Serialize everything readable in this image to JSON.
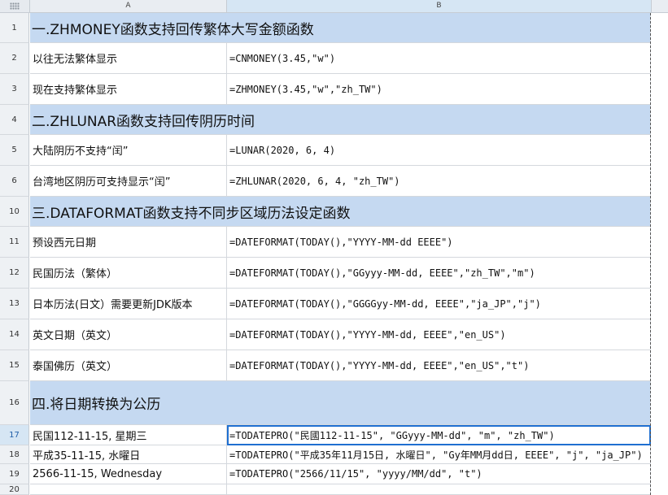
{
  "columns": {
    "a": "A",
    "b": "B"
  },
  "rows": [
    {
      "num": "1",
      "type": "header",
      "text": "一.ZHMONEY函数支持回传繁体大写金额函数"
    },
    {
      "num": "2",
      "type": "data",
      "a": "以往无法繁体显示",
      "b": "=CNMONEY(3.45,\"w\")"
    },
    {
      "num": "3",
      "type": "data",
      "a": "现在支持繁体显示",
      "b": "=ZHMONEY(3.45,\"w\",\"zh_TW\")"
    },
    {
      "num": "4",
      "type": "header",
      "text": "二.ZHLUNAR函数支持回传阴历时间"
    },
    {
      "num": "5",
      "type": "data",
      "a": "大陆阴历不支持“闰”",
      "b": "=LUNAR(2020, 6, 4)"
    },
    {
      "num": "6",
      "type": "data",
      "a": "台湾地区阴历可支持显示“闰”",
      "b": "=ZHLUNAR(2020, 6, 4, \"zh_TW\")"
    },
    {
      "num": "10",
      "type": "header",
      "text": "三.DATAFORMAT函数支持不同步区域历法设定函数"
    },
    {
      "num": "11",
      "type": "data",
      "a": "预设西元日期",
      "b": "=DATEFORMAT(TODAY(),\"YYYY-MM-dd EEEE\")"
    },
    {
      "num": "12",
      "type": "data",
      "a": "民国历法（繁体）",
      "b": "=DATEFORMAT(TODAY(),\"GGyyy-MM-dd, EEEE\",\"zh_TW\",\"m\")"
    },
    {
      "num": "13",
      "type": "data",
      "a": "日本历法(日文）需要更新JDK版本",
      "b": "=DATEFORMAT(TODAY(),\"GGGGyy-MM-dd, EEEE\",\"ja_JP\",\"j\")"
    },
    {
      "num": "14",
      "type": "data",
      "a": "英文日期（英文）",
      "b": "=DATEFORMAT(TODAY(),\"YYYY-MM-dd, EEEE\",\"en_US\")"
    },
    {
      "num": "15",
      "type": "data",
      "a": "泰国佛历（英文）",
      "b": "=DATEFORMAT(TODAY(),\"YYYY-MM-dd, EEEE\",\"en_US\",\"t\")"
    },
    {
      "num": "16",
      "type": "header",
      "text": "四.将日期转换为公历"
    },
    {
      "num": "17",
      "type": "data",
      "a": "民国112-11-15, 星期三",
      "b": "=TODATEPRO(\"民國112-11-15\", \"GGyyy-MM-dd\", \"m\", \"zh_TW\")"
    },
    {
      "num": "18",
      "type": "data",
      "a": "平成35-11-15, 水曜日",
      "b": "=TODATEPRO(\"平成35年11月15日, 水曜日\", \"Gy年MM月dd日, EEEE\", \"j\", \"ja_JP\")"
    },
    {
      "num": "19",
      "type": "data",
      "a": "2566-11-15, Wednesday",
      "b": "=TODATEPRO(\"2566/11/15\", \"yyyy/MM/dd\", \"t\")"
    },
    {
      "num": "20",
      "type": "data",
      "a": "",
      "b": ""
    }
  ]
}
